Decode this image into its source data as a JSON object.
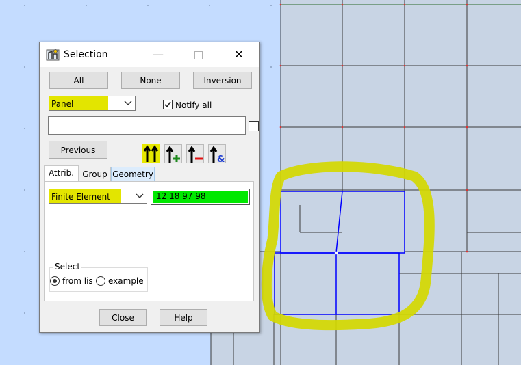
{
  "dialog": {
    "title": "Selection",
    "buttons": {
      "all": "All",
      "none": "None",
      "inversion": "Inversion",
      "previous": "Previous",
      "close": "Close",
      "help": "Help"
    },
    "mode_combo": {
      "value": "Panel"
    },
    "notify_all": {
      "label": "Notify all",
      "checked": true
    },
    "filter_input": {
      "value": ""
    },
    "icon_buttons": [
      "select-all-arrows-icon",
      "add-to-selection-icon",
      "remove-from-selection-icon",
      "intersect-selection-icon"
    ],
    "tabs": [
      {
        "label": "Attrib.",
        "active": true
      },
      {
        "label": "Group",
        "active": false
      },
      {
        "label": "Geometry",
        "active": false
      }
    ],
    "attrib": {
      "type_combo": {
        "value": "Finite Element"
      },
      "ids_field": {
        "value": "12 18 97 98"
      }
    },
    "select_group": {
      "label": "Select",
      "options": [
        {
          "label": "from lis",
          "selected": true
        },
        {
          "label": "example",
          "selected": false
        }
      ]
    }
  },
  "colors": {
    "canvas_background": "#c4dcff",
    "mesh_background": "#c8d4e4",
    "selected_elements": "#0000ff",
    "highlight_marker": "#d4d800",
    "ids_field_fill": "#00e800"
  }
}
